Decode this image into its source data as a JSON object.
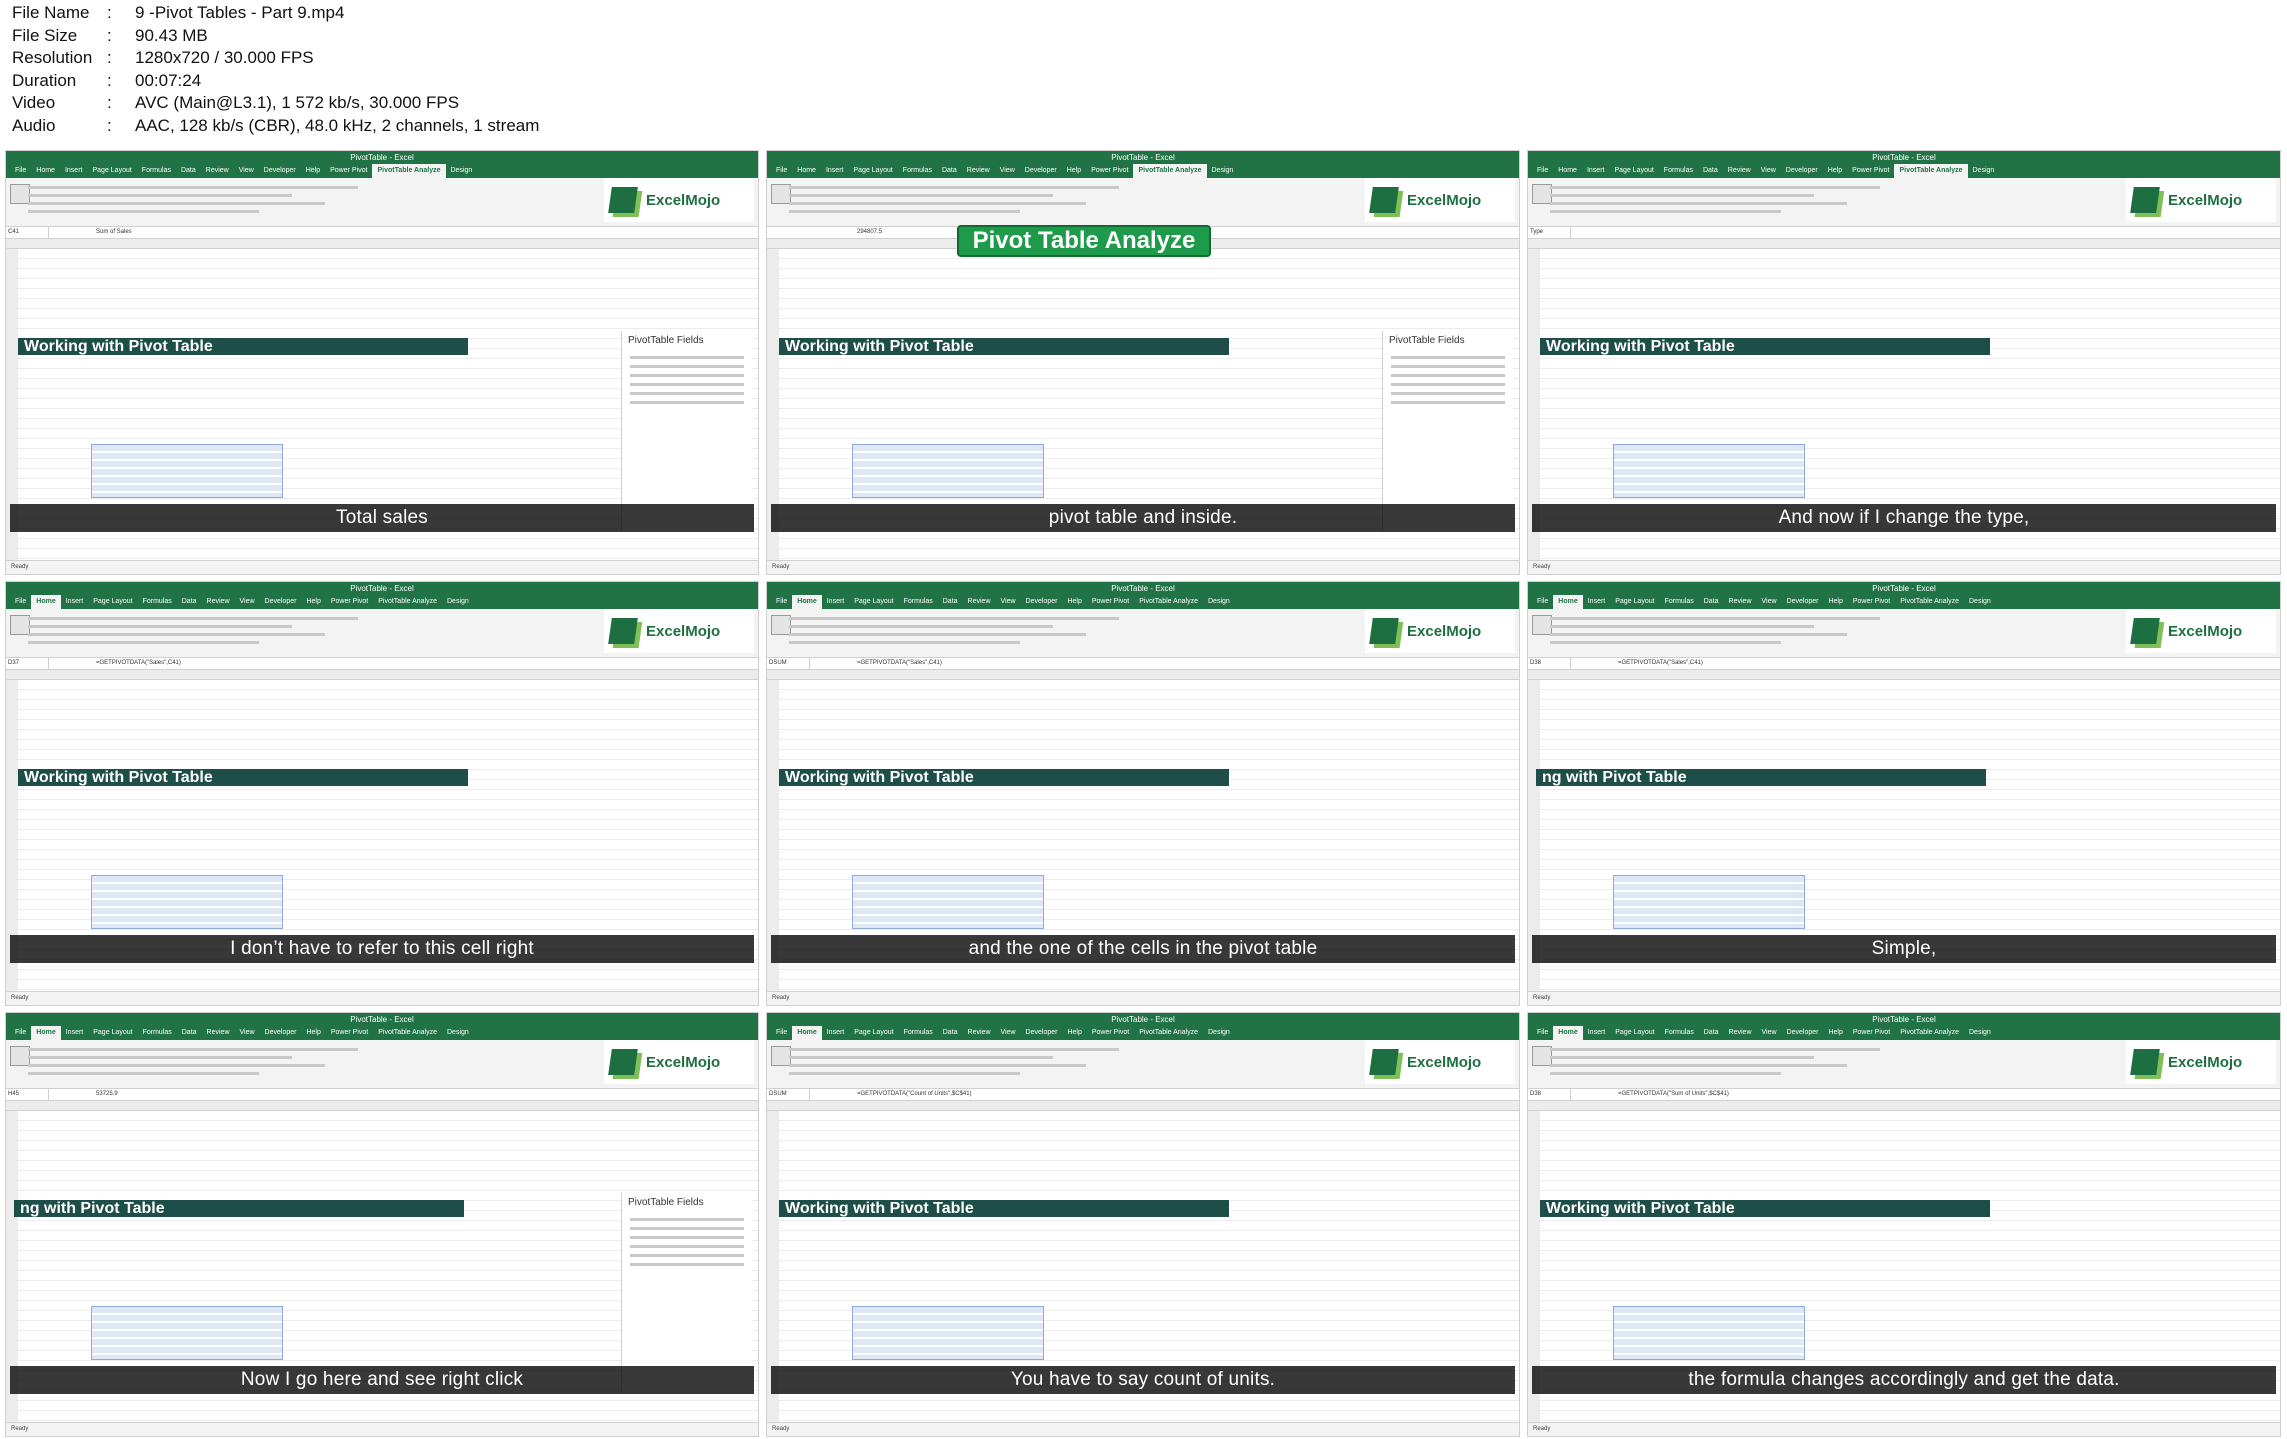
{
  "file_info": [
    {
      "key": "File Name",
      "value": "9 -Pivot Tables - Part 9.mp4"
    },
    {
      "key": "File Size",
      "value": "90.43 MB"
    },
    {
      "key": "Resolution",
      "value": "1280x720 / 30.000 FPS"
    },
    {
      "key": "Duration",
      "value": "00:07:24"
    },
    {
      "key": "Video",
      "value": "AVC (Main@L3.1), 1 572 kb/s, 30.000 FPS"
    },
    {
      "key": "Audio",
      "value": "AAC, 128 kb/s (CBR), 48.0 kHz, 2 channels, 1 stream"
    }
  ],
  "common": {
    "logo": "ExcelMojo",
    "sheet_banner": "Working with Pivot Table",
    "sheet_banner_cropped": "ng with Pivot Table",
    "panel_title": "PivotTable Fields",
    "status": "Ready",
    "tabs": [
      "File",
      "Home",
      "Insert",
      "Page Layout",
      "Formulas",
      "Data",
      "Review",
      "View",
      "Developer",
      "Help",
      "Power Pivot",
      "PivotTable Analyze",
      "Design"
    ]
  },
  "colors": {
    "excel_green": "#217346",
    "banner": "#1d4e47",
    "caption_bg": "#000000",
    "badge_green": "#1e9b4a"
  },
  "thumbs": [
    {
      "caption": "Total sales",
      "namebox": "C41",
      "formula": "Sum of Sales",
      "active_tab": 11,
      "banner_full": true,
      "panel": true,
      "badge": null
    },
    {
      "caption": "pivot table and inside.",
      "namebox": "",
      "formula": "294807.5",
      "active_tab": 11,
      "banner_full": true,
      "panel": true,
      "badge": "Pivot Table Analyze"
    },
    {
      "caption": "And now if I change the type,",
      "namebox": "Type",
      "formula": "",
      "active_tab": 11,
      "banner_full": true,
      "panel": false,
      "badge": null
    },
    {
      "caption": "I don’t have to refer to this cell right",
      "namebox": "D37",
      "formula": "=GETPIVOTDATA(\"Sales\",C41)",
      "active_tab": 1,
      "banner_full": true,
      "panel": false,
      "badge": null
    },
    {
      "caption": "and the one of the cells in the pivot table",
      "namebox": "DSUM",
      "formula": "=GETPIVOTDATA(\"Sales\",C41)",
      "active_tab": 1,
      "banner_full": true,
      "panel": false,
      "badge": null
    },
    {
      "caption": "Simple,",
      "namebox": "D38",
      "formula": "=GETPIVOTDATA(\"Sales\",C41)",
      "active_tab": 1,
      "banner_full": false,
      "panel": false,
      "badge": null
    },
    {
      "caption": "Now I go here and see right click",
      "namebox": "H45",
      "formula": "53725.9",
      "active_tab": 1,
      "banner_full": false,
      "panel": true,
      "badge": null
    },
    {
      "caption": "You have to say count of units.",
      "namebox": "DSUM",
      "formula": "=GETPIVOTDATA(\"Count of Units\",$C$41)",
      "active_tab": 1,
      "banner_full": true,
      "panel": false,
      "badge": null
    },
    {
      "caption": "the formula changes accordingly and get the data.",
      "namebox": "D38",
      "formula": "=GETPIVOTDATA(\"Sum of Units\",$C$41)",
      "active_tab": 1,
      "banner_full": true,
      "panel": false,
      "badge": null
    }
  ]
}
